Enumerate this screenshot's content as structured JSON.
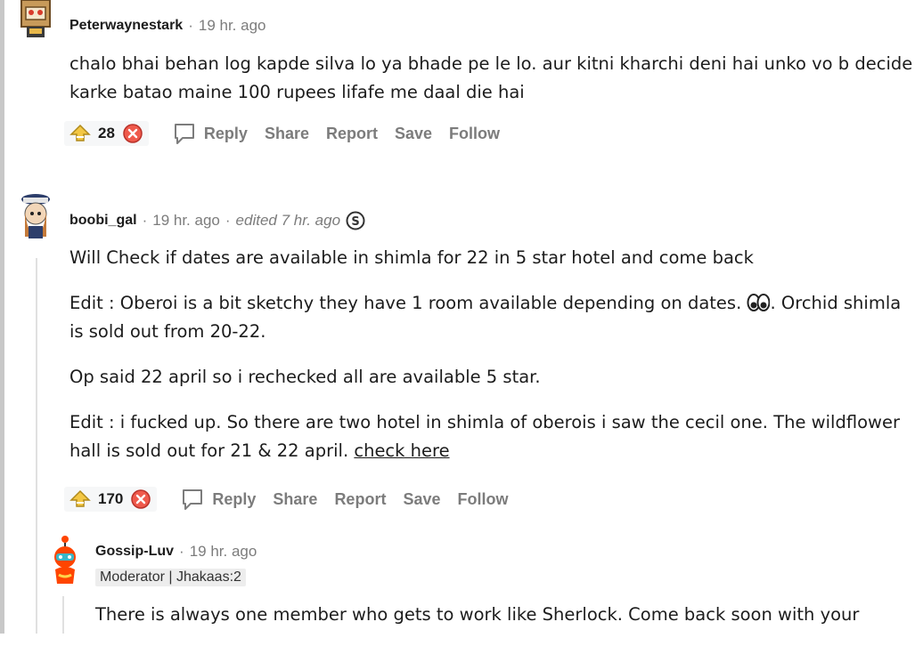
{
  "comments": [
    {
      "author": "Peterwaynestark",
      "time": "19 hr. ago",
      "body": [
        "chalo bhai behan log kapde silva lo ya bhade pe le lo. aur kitni kharchi deni hai unko vo b decide karke batao maine 100 rupees lifafe me daal die hai"
      ],
      "score": "28",
      "actions": {
        "reply": "Reply",
        "share": "Share",
        "report": "Report",
        "save": "Save",
        "follow": "Follow"
      }
    },
    {
      "author": "boobi_gal",
      "time": "19 hr. ago",
      "edited": "edited 7 hr. ago",
      "body": [
        "Will Check if dates are available in shimla for 22 in 5 star hotel and come back",
        "Edit : Oberoi is a bit sketchy they have 1 room available depending on dates.",
        ". Orchid shimla is sold out from 20-22.",
        "Op said 22 april so i rechecked all are available 5 star.",
        "Edit : i fucked up. So there are two hotel in shimla of oberois i saw the cecil one. The wildflower hall is sold out for 21 & 22 april.",
        "check here"
      ],
      "score": "170",
      "actions": {
        "reply": "Reply",
        "share": "Share",
        "report": "Report",
        "save": "Save",
        "follow": "Follow"
      }
    },
    {
      "author": "Gossip-Luv",
      "time": "19 hr. ago",
      "flair": "Moderator | Jhakaas:2",
      "body": [
        "There is always one member who gets to work like Sherlock. Come back soon with your"
      ]
    }
  ],
  "separators": {
    "dot": "·"
  }
}
